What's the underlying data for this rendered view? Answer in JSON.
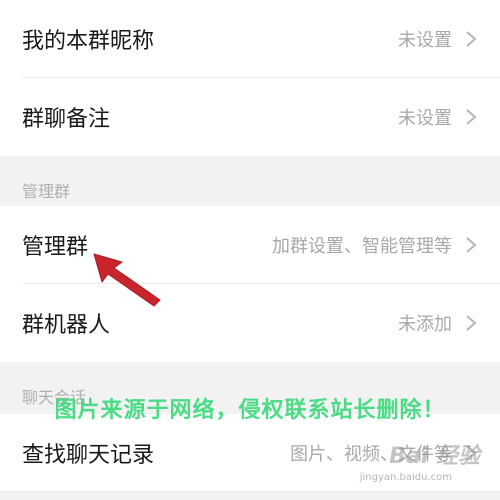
{
  "rows": {
    "nickname": {
      "label": "我的本群昵称",
      "value": "未设置"
    },
    "remark": {
      "label": "群聊备注",
      "value": "未设置"
    },
    "manage": {
      "label": "管理群",
      "value": "加群设置、智能管理等"
    },
    "robot": {
      "label": "群机器人",
      "value": "未添加"
    },
    "search": {
      "label": "查找聊天记录",
      "value": "图片、视频、文件等"
    }
  },
  "sections": {
    "manage_header": "管理群",
    "chat_header": "聊天会话"
  },
  "watermark": {
    "text": "图片来源于网络，侵权联系站长删除！",
    "baidu": "Bai 经验",
    "baidu_sub": "jingyan.baidu.com"
  },
  "colors": {
    "accent_arrow": "#c8242b",
    "watermark_green": "#3bd97a",
    "background": "#f2f2f2",
    "row_bg": "#ffffff"
  },
  "icons": {
    "chevron": "chevron-right-icon",
    "arrow": "red-pointer-arrow"
  }
}
